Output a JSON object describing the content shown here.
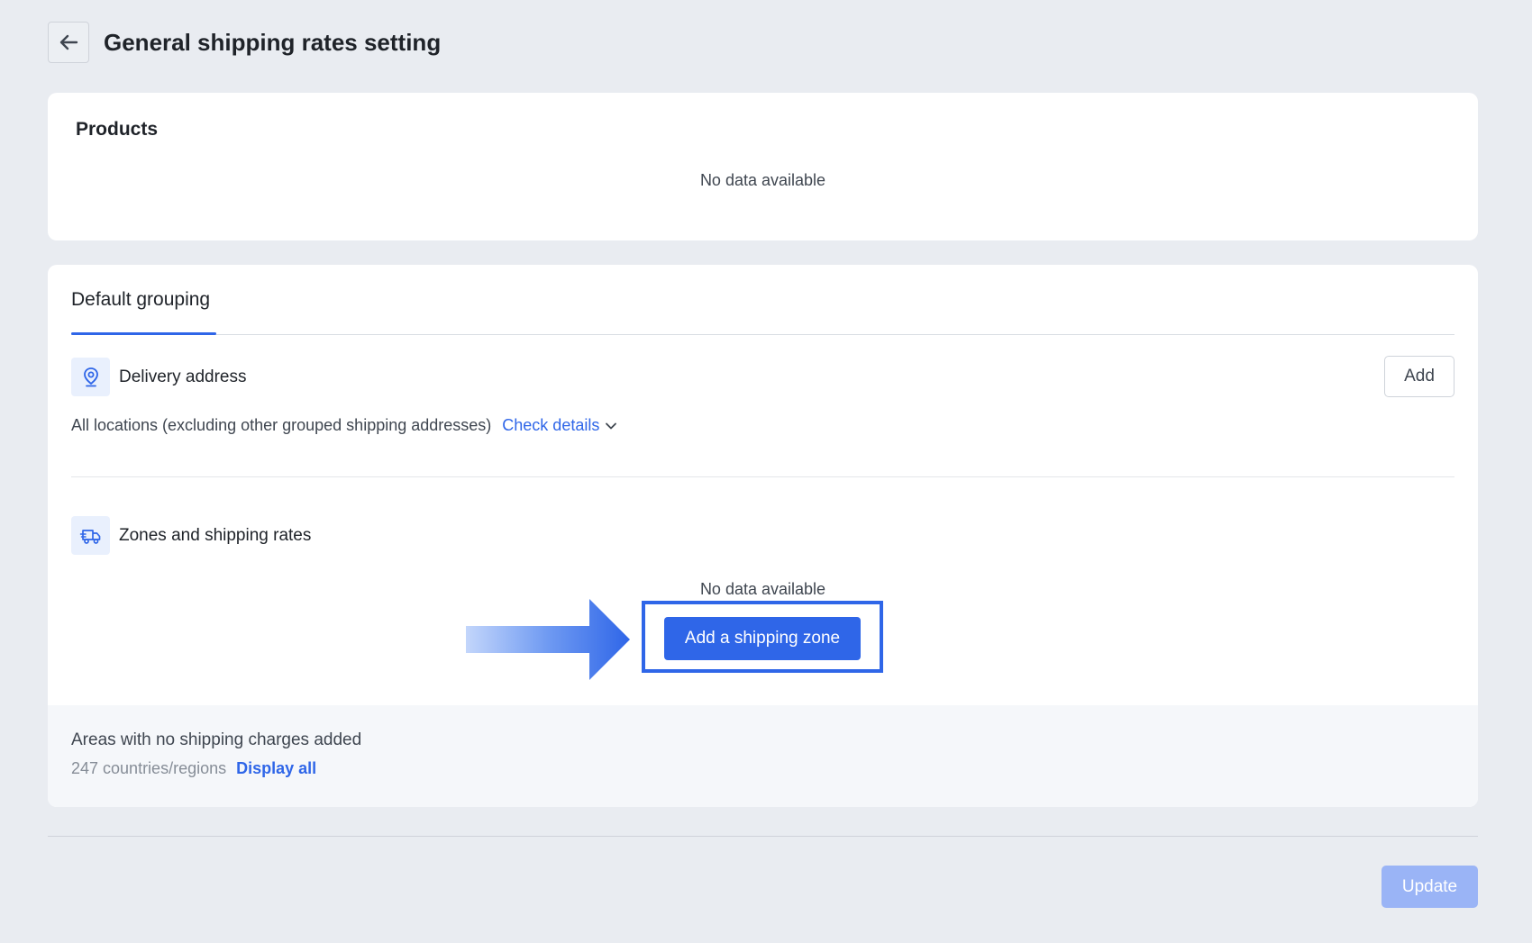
{
  "header": {
    "title": "General shipping rates setting",
    "back_icon": "arrow-left-icon"
  },
  "products": {
    "title": "Products",
    "empty_text": "No data available"
  },
  "grouping": {
    "tab_label": "Default grouping",
    "delivery_address": {
      "icon": "location-pin-icon",
      "label": "Delivery address",
      "add_label": "Add",
      "locations_text": "All locations (excluding other grouped shipping addresses)",
      "check_details_label": "Check details"
    },
    "zones": {
      "icon": "delivery-truck-icon",
      "label": "Zones and shipping rates",
      "empty_text": "No data available",
      "add_zone_label": "Add a shipping zone"
    },
    "footer": {
      "title": "Areas with no shipping charges added",
      "count_text": "247 countries/regions",
      "display_all_label": "Display all"
    }
  },
  "actions": {
    "update_label": "Update"
  },
  "colors": {
    "accent": "#2f66e8",
    "background": "#e9ecf1",
    "update_disabled": "#9ab4f6"
  }
}
